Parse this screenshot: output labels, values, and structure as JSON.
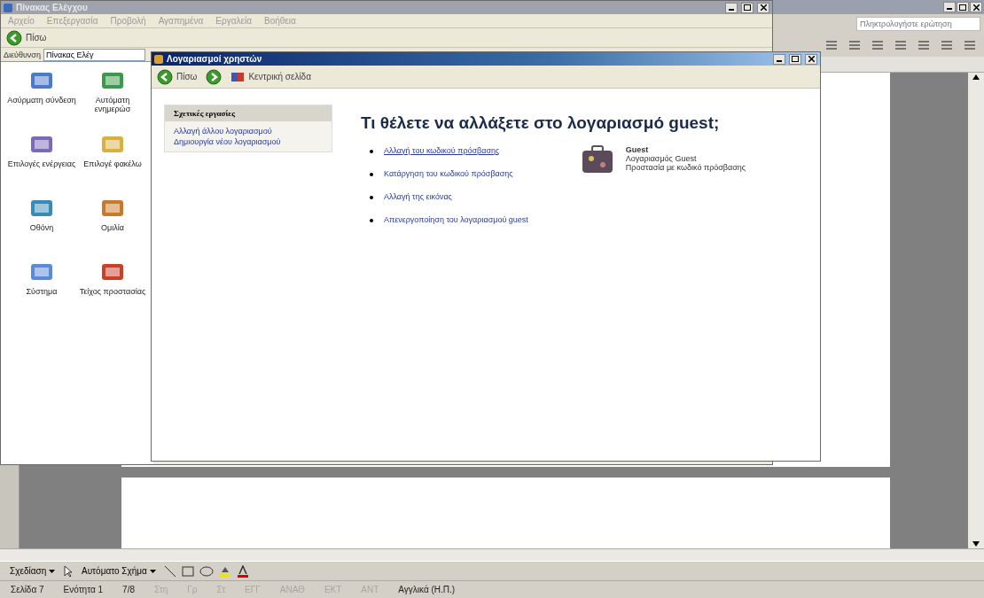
{
  "word": {
    "help_field": {
      "placeholder": "Πληκτρολογήστε ερώτηση"
    },
    "drawing_toolbar": {
      "draw_menu": "Σχεδίαση",
      "autoshapes_menu": "Αυτόματο Σχήμα"
    },
    "status_bar": [
      {
        "text": "Σελίδα 7",
        "disabled": false
      },
      {
        "text": "Ενότητα 1",
        "disabled": false
      },
      {
        "text": "7/8",
        "disabled": false
      },
      {
        "text": "Στη",
        "disabled": true
      },
      {
        "text": "Γρ",
        "disabled": true
      },
      {
        "text": "Στ",
        "disabled": true
      },
      {
        "text": "ΕΓΓ",
        "disabled": true
      },
      {
        "text": "ΑΝΑΘ",
        "disabled": true
      },
      {
        "text": "ΕΚΤ",
        "disabled": true
      },
      {
        "text": "ΑΝΤ",
        "disabled": true
      },
      {
        "text": "Αγγλικά (Η.Π.)",
        "disabled": false
      }
    ]
  },
  "control_panel": {
    "title": "Πίνακας Ελέγχου",
    "menu": [
      "Αρχείο",
      "Επεξεργασία",
      "Προβολή",
      "Αγαπημένα",
      "Εργαλεία",
      "Βοήθεια"
    ],
    "back": "Πίσω",
    "address_label": "Διεύθυνση",
    "address": "Πίνακας Ελέγ",
    "items": [
      {
        "label": "Ασύρματη σύνδεση"
      },
      {
        "label": "Αυτόματη ενημερώσ"
      },
      {
        "label": "Επιλογές ενέργειας"
      },
      {
        "label": "Επιλογέ φακέλω"
      },
      {
        "label": "Οθόνη"
      },
      {
        "label": "Ομιλία"
      },
      {
        "label": "Σύστημα"
      },
      {
        "label": "Τείχος προστασίας"
      }
    ]
  },
  "user_accounts": {
    "title": "Λογαριασμοί χρηστών",
    "back": "Πίσω",
    "home": "Κεντρική σελίδα",
    "related_tasks": {
      "title": "Σχετικές εργασίες",
      "links": [
        "Αλλαγή άλλου λογαριασμού",
        "Δημιουργία νέου λογαριασμού"
      ]
    },
    "heading": "Τι θέλετε να αλλάξετε στο λογαριασμό guest;",
    "options": [
      {
        "label": "Αλλαγή του κωδικού πρόσβασης",
        "selected": true
      },
      {
        "label": "Κατάργηση του κωδικού πρόσβασης",
        "selected": false
      },
      {
        "label": "Αλλαγή της εικόνας",
        "selected": false
      },
      {
        "label": "Απενεργοποίηση του λογαριασμού guest",
        "selected": false
      }
    ],
    "account": {
      "name": "Guest",
      "type": "Λογαριασμός Guest",
      "protection": "Προστασία με κωδικό πρόσβασης"
    }
  }
}
